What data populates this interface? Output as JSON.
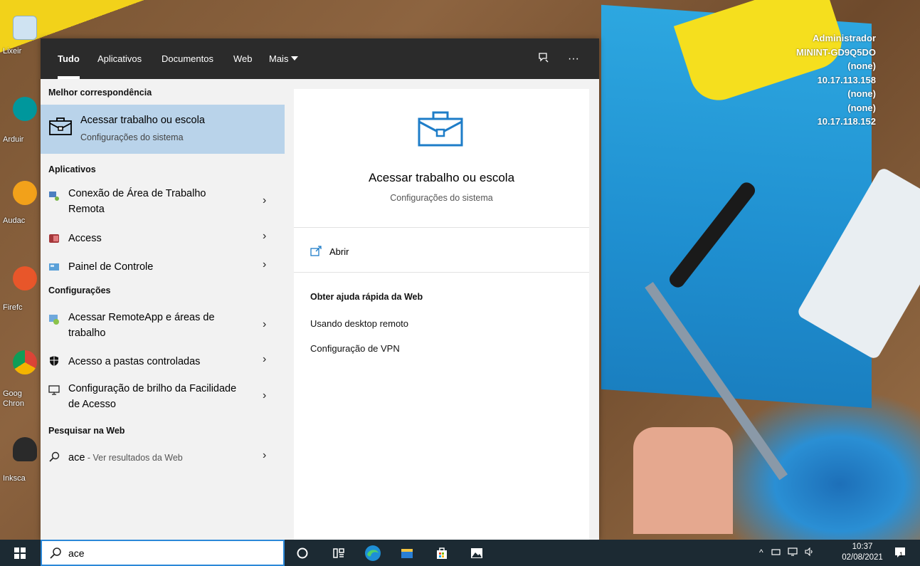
{
  "desktop": {
    "icons": [
      {
        "label": "Lixeir"
      },
      {
        "label": "Arduir"
      },
      {
        "label": "Audac"
      },
      {
        "label": "Firefc"
      },
      {
        "label": "Goog Chron"
      },
      {
        "label": "Inksca"
      }
    ],
    "sysinfo": [
      "Administrador",
      "MININT-GD9Q5DO",
      "(none)",
      "10.17.113.158",
      "(none)",
      "(none)",
      "10.17.118.152"
    ]
  },
  "topbar": {
    "tabs": [
      {
        "label": "Tudo"
      },
      {
        "label": "Aplicativos"
      },
      {
        "label": "Documentos"
      },
      {
        "label": "Web"
      },
      {
        "label": "Mais"
      }
    ],
    "feedback_icon": "feedback-icon",
    "more_icon": "···"
  },
  "results": {
    "best_match_header": "Melhor correspondência",
    "best_match": {
      "title": "Acessar trabalho ou escola",
      "subtitle": "Configurações do sistema"
    },
    "apps_header": "Aplicativos",
    "apps": [
      {
        "line1": "Conexão de Área de Trabalho",
        "line2": "Remota"
      },
      {
        "line1": "Access"
      },
      {
        "line1": "Painel de Controle"
      }
    ],
    "settings_header": "Configurações",
    "settings": [
      {
        "line1": "Acessar RemoteApp e áreas de",
        "line2": "trabalho"
      },
      {
        "line1": "Acesso a pastas controladas"
      },
      {
        "line1": "Configuração de brilho da Facilidade",
        "line2": "de Acesso"
      }
    ],
    "web_header": "Pesquisar na Web",
    "web": {
      "query": "ace",
      "suffix": " - Ver resultados da Web"
    }
  },
  "preview": {
    "title": "Acessar trabalho ou escola",
    "subtitle": "Configurações do sistema",
    "open_label": "Abrir",
    "web_help_header": "Obter ajuda rápida da Web",
    "links": [
      "Usando desktop remoto",
      "Configuração de VPN"
    ]
  },
  "taskbar": {
    "search_value": "ace",
    "time": "10:37",
    "date": "02/08/2021",
    "notification_count": "1"
  },
  "colors": {
    "accent": "#2b88d8",
    "selected_row": "#b9d3ea",
    "topbar": "#2b2b2b",
    "taskbar": "#1c2a33"
  }
}
